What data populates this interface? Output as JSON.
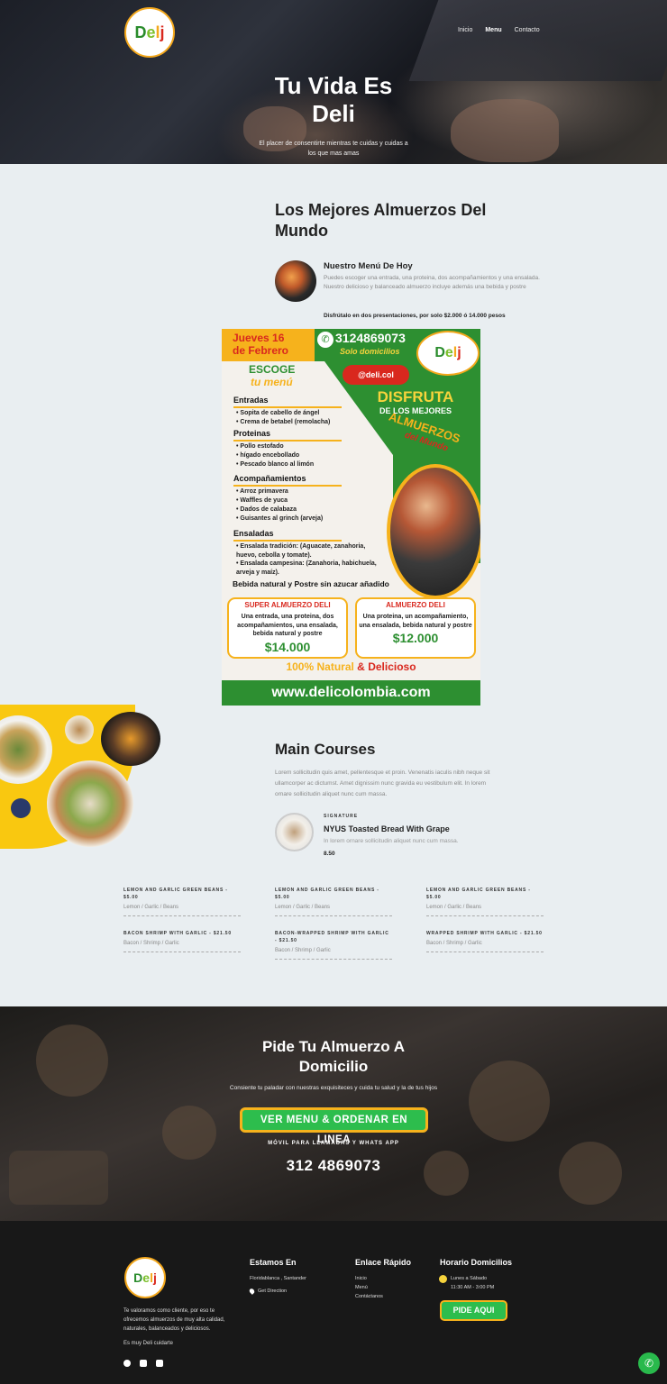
{
  "brand": {
    "logo_letters": [
      "D",
      "e",
      "l",
      "j"
    ],
    "colors": {
      "green": "#2a8c2c",
      "light_green": "#7bbf2b",
      "orange": "#f4a81c",
      "red": "#d9281e"
    }
  },
  "nav": {
    "items": [
      "Inicio",
      "Menu",
      "Contacto"
    ],
    "active": "Menu"
  },
  "hero": {
    "title_line1": "Tu Vida Es",
    "title_line2": "Deli",
    "subtitle": "El placer de consentirte mientras te cuidas y cuidas a los que mas amas"
  },
  "best": {
    "title": "Los Mejores Almuerzos Del Mundo",
    "menu_heading": "Nuestro Menú De Hoy",
    "menu_desc": "Puedes escoger una entrada, una proteina, dos acompañamientos y una ensalada. Nuestro delicioso y balanceado almuerzo incluye además una bebida y postre",
    "menu_price": "Disfrútalo en dos presentaciones, por solo $2.000 ó 14.000 pesos"
  },
  "flyer": {
    "date_line1": "Jueves 16",
    "date_line2": "de Febrero",
    "phone": "3124869073",
    "solo": "Solo domicilios",
    "instagram": "@deli.col",
    "escoge": "ESCOGE",
    "tu_menu": "tu menú",
    "disfruta": "DISFRUTA",
    "de_los_mejores": "DE LOS MEJORES",
    "almuerzos": "ALMUERZOS",
    "del_mundo": "del Mundo",
    "sections": [
      {
        "title": "Entradas",
        "items": [
          "Sopita de cabello de ángel",
          "Crema de betabel (remolacha)"
        ]
      },
      {
        "title": "Proteinas",
        "items": [
          "Pollo estofado",
          "hígado encebollado",
          "Pescado blanco al limón"
        ]
      },
      {
        "title": "Acompañamientos",
        "items": [
          "Arroz primavera",
          "Waffles de yuca",
          "Dados de calabaza",
          "Guisantes al grinch (arveja)"
        ]
      },
      {
        "title": "Ensaladas",
        "items": [
          "Ensalada tradición: (Aguacate, zanahoria, huevo, cebolla y tomate).",
          "Ensalada campesina: (Zanahoria, habichuela, arveja y maíz)."
        ]
      }
    ],
    "bebida": "Bebida natural y Postre sin azucar añadido",
    "box1": {
      "title": "SUPER ALMUERZO DELI",
      "desc": "Una entrada, una proteina, dos acompañamientos, una ensalada, bebida natural y postre",
      "price": "$14.000"
    },
    "box2": {
      "title": "ALMUERZO DELI",
      "desc": "Una proteina, un acompañamiento, una ensalada, bebida natural y postre",
      "price": "$12.000"
    },
    "natural_a": "100% Natural",
    "natural_amp": "&",
    "natural_b": "Delicioso",
    "website": "www.delicolombia.com"
  },
  "main_courses": {
    "title": "Main Courses",
    "desc": "Lorem sollicitudin quis amet, pellentesque et proin. Venenatis iaculis nibh neque sit ullamcorper ac dictumst. Amet dignissim nunc gravida eu vestibulum elit. In lorem ornare sollicitudin aliquet nunc cum massa.",
    "featured": {
      "tag": "SIGNATURE",
      "name": "NYUS Toasted Bread With Grape",
      "desc": "In lorem ornare sollicitudin aliquet nunc cum massa.",
      "price": "8.50"
    },
    "dishes": [
      {
        "name": "LEMON AND GARLIC GREEN BEANS - $5.00",
        "ingredients": "Lemon / Garlic / Beans"
      },
      {
        "name": "LEMON AND GARLIC GREEN BEANS - $5.00",
        "ingredients": "Lemon / Garlic / Beans"
      },
      {
        "name": "LEMON AND GARLIC GREEN BEANS - $5.00",
        "ingredients": "Lemon / Garlic / Beans"
      },
      {
        "name": "BACON SHRIMP WITH GARLIC - $21.50",
        "ingredients": "Bacon / Shrimp / Garlic"
      },
      {
        "name": "BACON-WRAPPED SHRIMP WITH GARLIC - $21.50",
        "ingredients": "Bacon / Shrimp / Garlic"
      },
      {
        "name": "WRAPPED SHRIMP WITH GARLIC - $21.50",
        "ingredients": "Bacon / Shrimp / Garlic"
      }
    ]
  },
  "order": {
    "title_line1": "Pide Tu Almuerzo A",
    "title_line2": "Domicilio",
    "subtitle": "Consiente tu paladar con nuestras exquisiteces y cuida tu salud y la de tus hijos",
    "button": "VER MENU & ORDENAR EN LINEA",
    "movil_label": "MÓVIL PARA LLAMADAS Y WHATS APP",
    "phone": "312 4869073"
  },
  "footer": {
    "about": "Te valoramos como cliente, por eso te ofrecemos almuerzos de muy alta calidad, naturales, balanceados y deliciosos.",
    "tagline": "Es muy Deli cuidarte",
    "col1": {
      "title": "Estamos En",
      "address": "Floridablanca , Santander",
      "direction": "Get Direction"
    },
    "col2": {
      "title": "Enlace Rápido",
      "links": [
        "Inicio",
        "Menú",
        "Contáctanos"
      ]
    },
    "col3": {
      "title": "Horario Domicilios",
      "days": "Lunes a Sábado",
      "hours": "11:30 AM - 3:00 PM",
      "button": "PIDE AQUI"
    }
  }
}
